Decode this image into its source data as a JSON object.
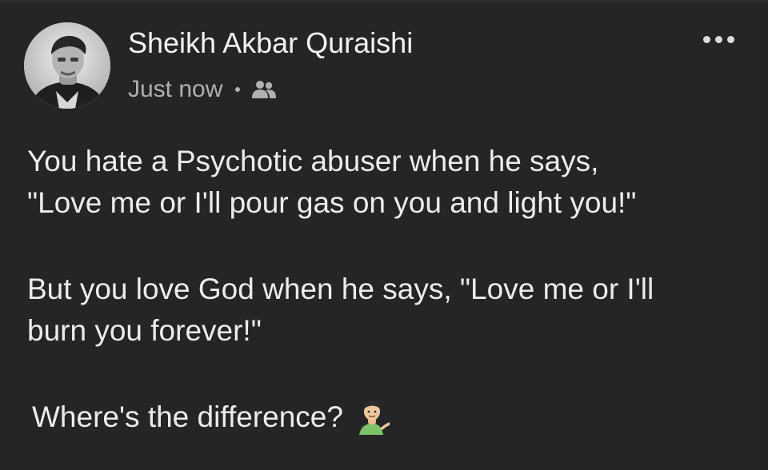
{
  "post": {
    "author": "Sheikh Akbar Quraishi",
    "timestamp": "Just now",
    "audience_icon": "friends-icon",
    "more_icon": "more-options-icon",
    "body": {
      "line1": "You hate a Psychotic abuser when he says,",
      "line2": "\"Love me or I'll pour gas on you and light you!\"",
      "line3": "But you love God when he says, \"Love me or I'll",
      "line4": "burn you forever!\"",
      "closing": "Where's the difference?",
      "closing_emoji": "person-tipping-hand-emoji"
    }
  },
  "colors": {
    "background": "#252527",
    "text_primary": "#ececec",
    "text_secondary": "#b0b0b2",
    "emoji_shirt": "#7cc36a"
  }
}
